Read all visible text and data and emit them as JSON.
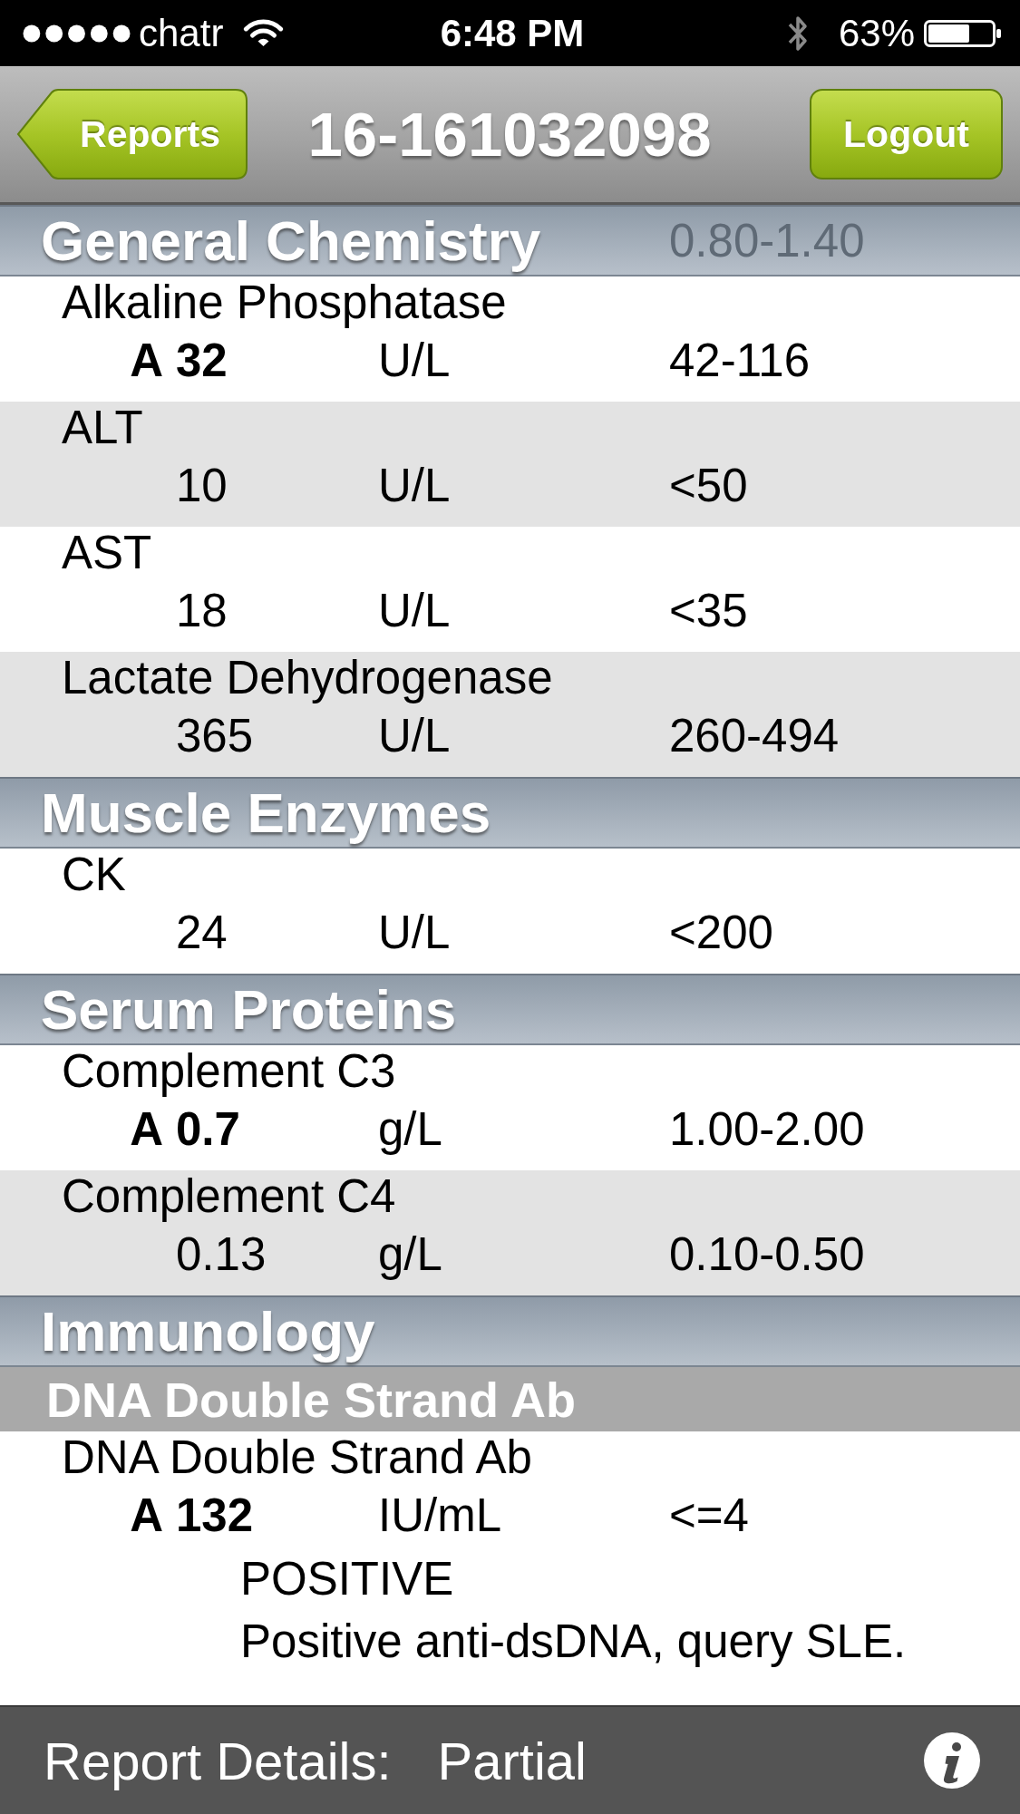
{
  "status_bar": {
    "carrier": "chatr",
    "time": "6:48 PM",
    "battery": "63%"
  },
  "nav_bar": {
    "back_button": "Reports",
    "title": "16-161032098",
    "right_button": "Logout"
  },
  "sections": [
    {
      "title": "General Chemistry",
      "partly_hidden_row": {
        "reference": "0.80-1.40"
      },
      "tests": [
        {
          "name": "Alkaline Phosphatase",
          "flag": "A",
          "abnormal": true,
          "value": "32",
          "unit": "U/L",
          "reference": "42-116"
        },
        {
          "name": "ALT",
          "abnormal": false,
          "value": "10",
          "unit": "U/L",
          "reference": "<50"
        },
        {
          "name": "AST",
          "abnormal": false,
          "value": "18",
          "unit": "U/L",
          "reference": "<35"
        },
        {
          "name": "Lactate Dehydrogenase",
          "abnormal": false,
          "value": "365",
          "unit": "U/L",
          "reference": "260-494"
        }
      ]
    },
    {
      "title": "Muscle Enzymes",
      "tests": [
        {
          "name": "CK",
          "abnormal": false,
          "value": "24",
          "unit": "U/L",
          "reference": "<200"
        }
      ]
    },
    {
      "title": "Serum Proteins",
      "tests": [
        {
          "name": "Complement C3",
          "flag": "A",
          "abnormal": true,
          "value": "0.7",
          "unit": "g/L",
          "reference": "1.00-2.00"
        },
        {
          "name": "Complement C4",
          "abnormal": false,
          "value": "0.13",
          "unit": "g/L",
          "reference": "0.10-0.50"
        }
      ]
    },
    {
      "title": "Immunology",
      "groups": [
        {
          "title": "DNA Double Strand Ab",
          "tests": [
            {
              "name": "DNA Double Strand Ab",
              "flag": "A",
              "abnormal": true,
              "value": "132",
              "unit": "IU/mL",
              "reference": "<=4",
              "comments": [
                "POSITIVE",
                "Positive anti-dsDNA, query SLE."
              ]
            }
          ]
        }
      ]
    }
  ],
  "footer": {
    "label": "Report Details:",
    "status": "Partial"
  }
}
